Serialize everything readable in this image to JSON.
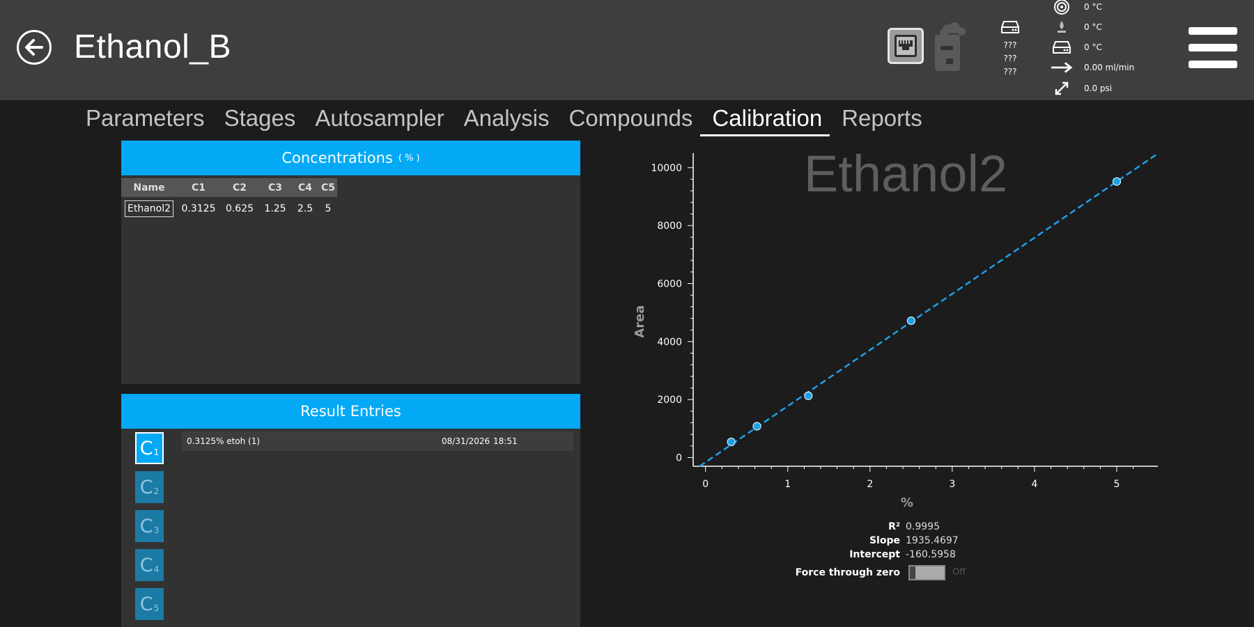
{
  "header": {
    "title": "Ethanol_B",
    "autosampler_values": [
      "???",
      "???",
      "???"
    ],
    "status": {
      "oven_temp": "0 °C",
      "injector_temp": "0 °C",
      "detector_temp": "0 °C",
      "flow": "0.00 ml/min",
      "pressure": "0.0  psi"
    }
  },
  "tabs": [
    "Parameters",
    "Stages",
    "Autosampler",
    "Analysis",
    "Compounds",
    "Calibration",
    "Reports"
  ],
  "active_tab": "Calibration",
  "concentrations": {
    "title": "Concentrations",
    "unit": "( % )",
    "columns": [
      "Name",
      "C1",
      "C2",
      "C3",
      "C4",
      "C5"
    ],
    "rows": [
      [
        "Ethanol2",
        "0.3125",
        "0.625",
        "1.25",
        "2.5",
        "5"
      ]
    ]
  },
  "results": {
    "title": "Result Entries",
    "levels": [
      {
        "letter": "C",
        "index": "1"
      },
      {
        "letter": "C",
        "index": "2"
      },
      {
        "letter": "C",
        "index": "3"
      },
      {
        "letter": "C",
        "index": "4"
      },
      {
        "letter": "C",
        "index": "5"
      }
    ],
    "active_level": 0,
    "entries": [
      {
        "name": "0.3125% etoh (1)",
        "date": "08/31/2026",
        "time": "18:51"
      }
    ]
  },
  "stats": {
    "r2_label": "R²",
    "r2": "0.9995",
    "slope_label": "Slope",
    "slope": "1935.4697",
    "intercept_label": "Intercept",
    "intercept": "-160.5958",
    "force_zero_label": "Force through zero",
    "force_zero_state": "Off"
  },
  "colors": {
    "accent": "#03a9f4",
    "header_bg": "#3e3e3e",
    "panel_bg": "#323232",
    "line": "#1e9fe8"
  },
  "chart_data": {
    "type": "scatter",
    "title": "Ethanol2",
    "xlabel": "%",
    "ylabel": "Area",
    "xlim": [
      -0.15,
      5.5
    ],
    "ylim": [
      -300,
      10500
    ],
    "xticks": [
      0,
      1,
      2,
      3,
      4,
      5
    ],
    "yticks": [
      0,
      2000,
      4000,
      6000,
      8000,
      10000
    ],
    "points": {
      "x": [
        0.3125,
        0.625,
        1.25,
        2.5,
        5
      ],
      "y": [
        540,
        1080,
        2130,
        4720,
        9520
      ]
    },
    "fit": {
      "slope": 1935.4697,
      "intercept": -160.5958,
      "style": "dashed"
    },
    "grid": false
  }
}
